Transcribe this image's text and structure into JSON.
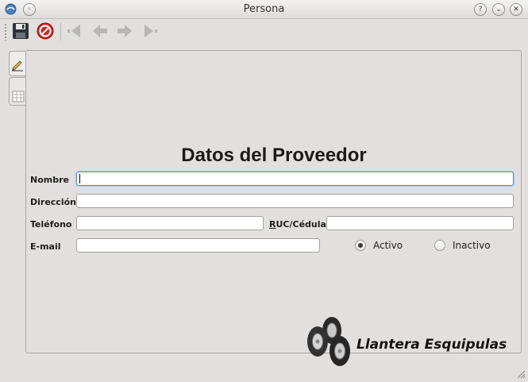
{
  "window": {
    "title": "Persona"
  },
  "form": {
    "heading": "Datos del Proveedor",
    "nombre_label": "Nombre",
    "nombre_value": "",
    "direccion_label": "Dirección",
    "direccion_value": "",
    "telefono_label": "Teléfono",
    "telefono_value": "",
    "ruc_label": "RUC/Cédula:",
    "ruc_value": "",
    "email_label": "E-mail",
    "email_value": "",
    "status_options": [
      {
        "label": "Activo",
        "selected": true
      },
      {
        "label": "Inactivo",
        "selected": false
      }
    ]
  },
  "brand": {
    "name": "Llantera Esquipulas"
  },
  "colors": {
    "focus": "#5a8fd0",
    "stop_icon": "#d42020",
    "nav_disabled": "#b8b6b3"
  }
}
